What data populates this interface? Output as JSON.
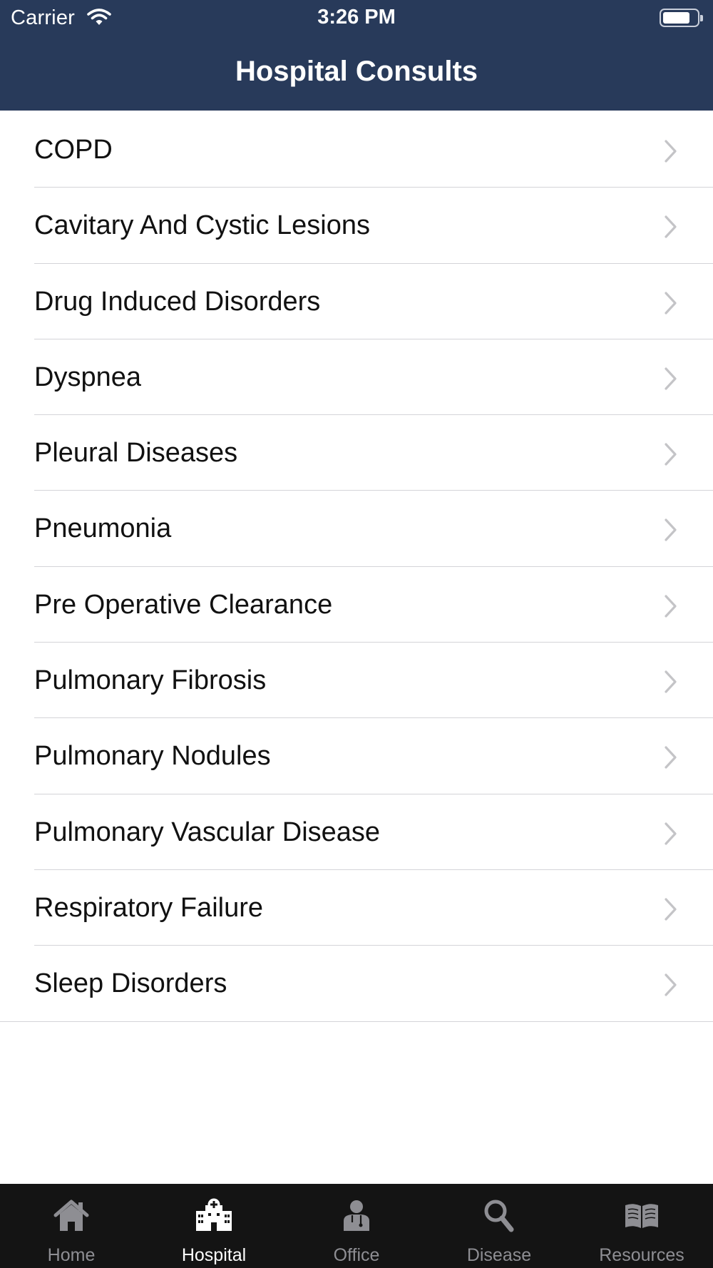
{
  "status_bar": {
    "carrier": "Carrier",
    "time": "3:26 PM",
    "battery_fraction": 0.8
  },
  "nav": {
    "title": "Hospital Consults"
  },
  "list": {
    "items": [
      {
        "label": "COPD"
      },
      {
        "label": "Cavitary And Cystic Lesions"
      },
      {
        "label": "Drug Induced Disorders"
      },
      {
        "label": "Dyspnea"
      },
      {
        "label": "Pleural Diseases"
      },
      {
        "label": "Pneumonia"
      },
      {
        "label": "Pre Operative Clearance"
      },
      {
        "label": "Pulmonary Fibrosis"
      },
      {
        "label": "Pulmonary Nodules"
      },
      {
        "label": "Pulmonary Vascular Disease"
      },
      {
        "label": "Respiratory Failure"
      },
      {
        "label": "Sleep Disorders"
      }
    ]
  },
  "tab_bar": {
    "active": "hospital",
    "tabs": [
      {
        "label": "Home",
        "icon": "home-icon"
      },
      {
        "label": "Hospital",
        "icon": "hospital-icon"
      },
      {
        "label": "Office",
        "icon": "doctor-icon"
      },
      {
        "label": "Disease",
        "icon": "magnifier-icon"
      },
      {
        "label": "Resources",
        "icon": "book-icon"
      }
    ]
  },
  "colors": {
    "header_background": "#283a5a",
    "tab_bar_background": "#141414",
    "tab_active": "#ffffff",
    "tab_inactive": "#8e8e93",
    "divider": "#d4d4d8",
    "chevron": "#c4c4c7"
  }
}
